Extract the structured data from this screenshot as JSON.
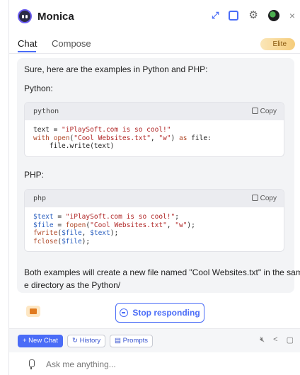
{
  "app": {
    "title": "Monica"
  },
  "header_icons": [
    "expand-icon",
    "note-icon",
    "gear-icon",
    "avatar-icon",
    "close-icon"
  ],
  "tabs": [
    {
      "label": "Chat",
      "active": true
    },
    {
      "label": "Compose",
      "active": false
    }
  ],
  "badge": {
    "label": "Elite"
  },
  "message": {
    "intro": "Sure, here are the examples in Python and PHP:",
    "python_label": "Python:",
    "php_label": "PHP:",
    "outro_1": "Both examples will create a new file named \"Cool Websites.txt\" in the sam",
    "outro_2": "e directory as the Python/",
    "python_block": {
      "lang": "python",
      "copy": "Copy",
      "lines": [
        "text = \"iPlaySoft.com is so cool!\"",
        "with open(\"Cool Websites.txt\", \"w\") as file:",
        "    file.write(text)"
      ]
    },
    "php_block": {
      "lang": "php",
      "copy": "Copy",
      "lines": [
        "$text = \"iPlaySoft.com is so cool!\";",
        "$file = fopen(\"Cool Websites.txt\", \"w\");",
        "fwrite($file, $text);",
        "fclose($file);"
      ]
    }
  },
  "stop_button": {
    "label": "Stop responding"
  },
  "toolbar": {
    "new_chat": "+ New Chat",
    "history": "History",
    "prompts": "Prompts"
  },
  "input": {
    "placeholder": "Ask me anything..."
  },
  "colors": {
    "accent": "#4a6cf7",
    "elite_bg": "#f5cc7a"
  }
}
